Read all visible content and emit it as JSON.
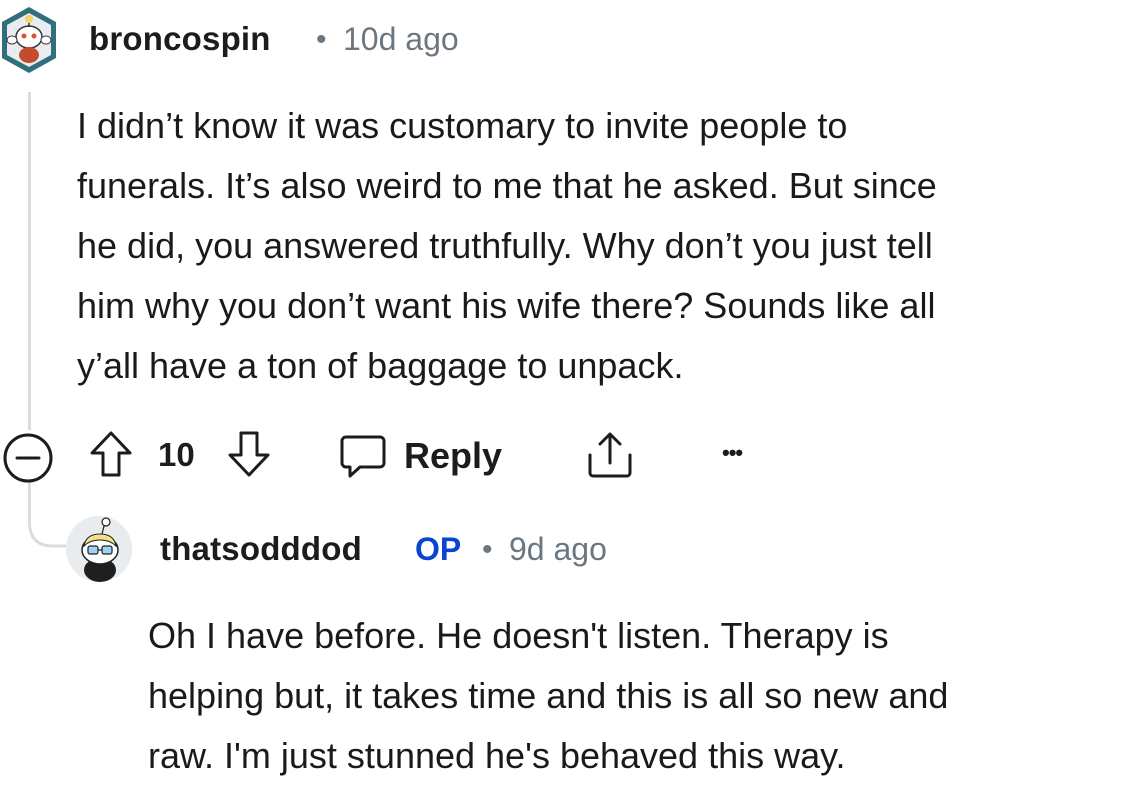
{
  "comments": [
    {
      "username": "broncospin",
      "separator": "•",
      "time": "10d ago",
      "avatar_icon": "snoo-avatar-icon",
      "body": "I didn’t know it was customary to invite people to funerals. It’s also weird to me that he asked. But since he did, you answered truthfully. Why don’t you just tell him why you don’t want his wife there? Sounds like all y’all have a ton of baggage to unpack.",
      "body_lines": [
        "I didn’t know it was customary to invite people to",
        "funerals. It’s also weird to me that he asked. But since",
        "he did, you answered truthfully. Why don’t you just tell",
        "him why you don’t want his wife there? Sounds like all",
        "y’all have a ton of baggage to unpack."
      ],
      "actions": {
        "collapse_icon": "collapse-icon",
        "upvote_icon": "upvote-icon",
        "score": "10",
        "downvote_icon": "downvote-icon",
        "reply_icon": "speech-bubble-icon",
        "reply_label": "Reply",
        "share_icon": "share-icon",
        "more_label": "•••"
      }
    },
    {
      "username": "thatsodddod",
      "badge": "OP",
      "separator": "•",
      "time": "9d ago",
      "avatar_icon": "snoo-avatar-icon",
      "body_lines": [
        "Oh I have before. He doesn't listen. Therapy is",
        "helping but, it takes time and this is all so new and",
        "raw. I'm just stunned he's behaved this way."
      ]
    }
  ],
  "colors": {
    "text": "#1a1a1b",
    "meta": "#6b7780",
    "op_badge": "#0a44d1",
    "thread_line": "#d9dde0"
  }
}
